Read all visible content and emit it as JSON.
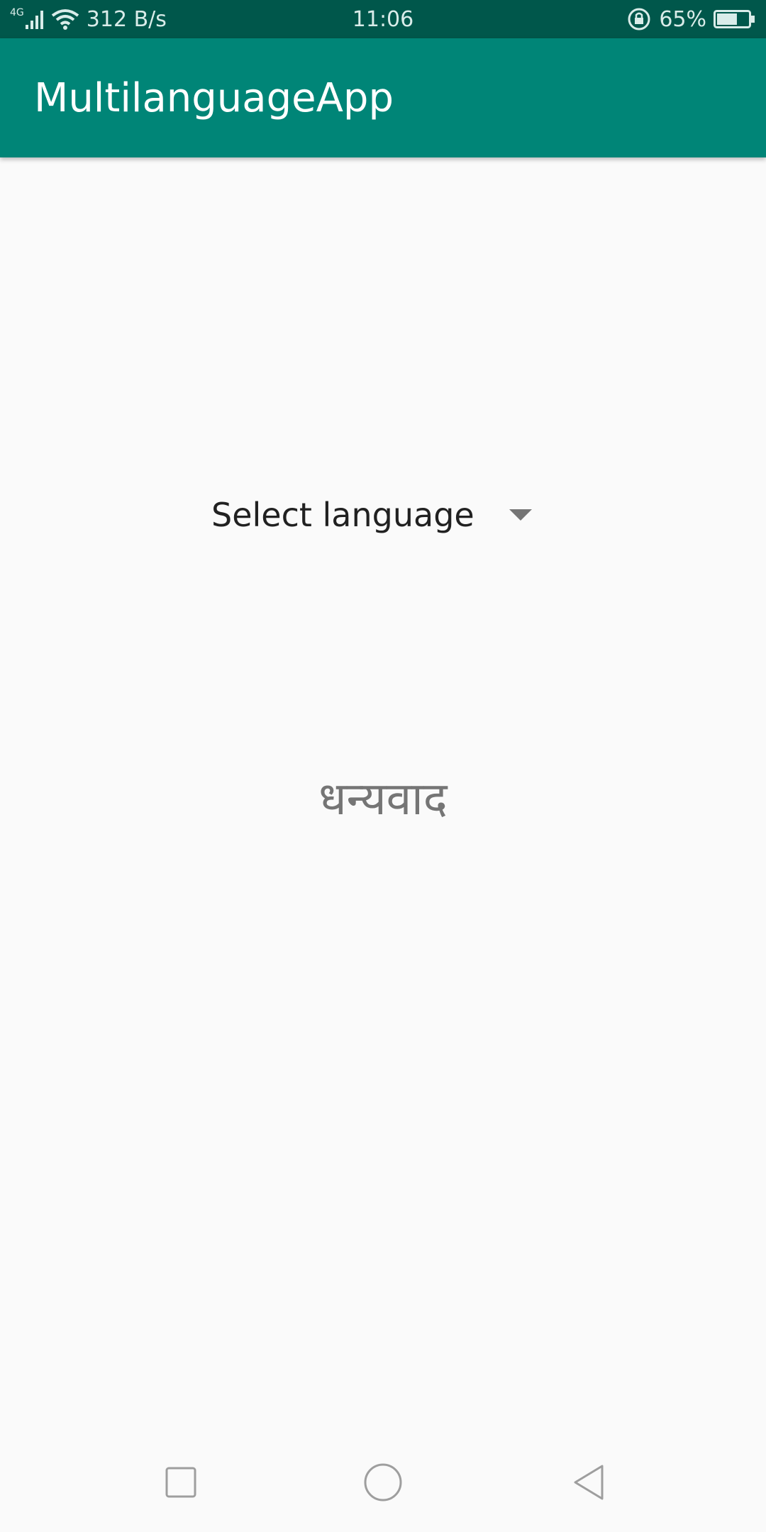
{
  "status_bar": {
    "network_type": "4G",
    "speed": "312 B/s",
    "time": "11:06",
    "battery": "65%",
    "battery_level": 0.65,
    "icons": [
      "signal-icon",
      "wifi-icon",
      "rotation-lock-icon",
      "battery-icon"
    ]
  },
  "app_bar": {
    "title": "MultilanguageApp",
    "color": "#008577"
  },
  "main": {
    "spinner_label": "Select language",
    "greeting": "धन्यवाद"
  },
  "nav_bar": {
    "icons": [
      "recent-apps-icon",
      "home-icon",
      "back-icon"
    ]
  },
  "colors": {
    "status_bar": "#00574b",
    "app_bar": "#008577",
    "background": "#fafafa"
  }
}
